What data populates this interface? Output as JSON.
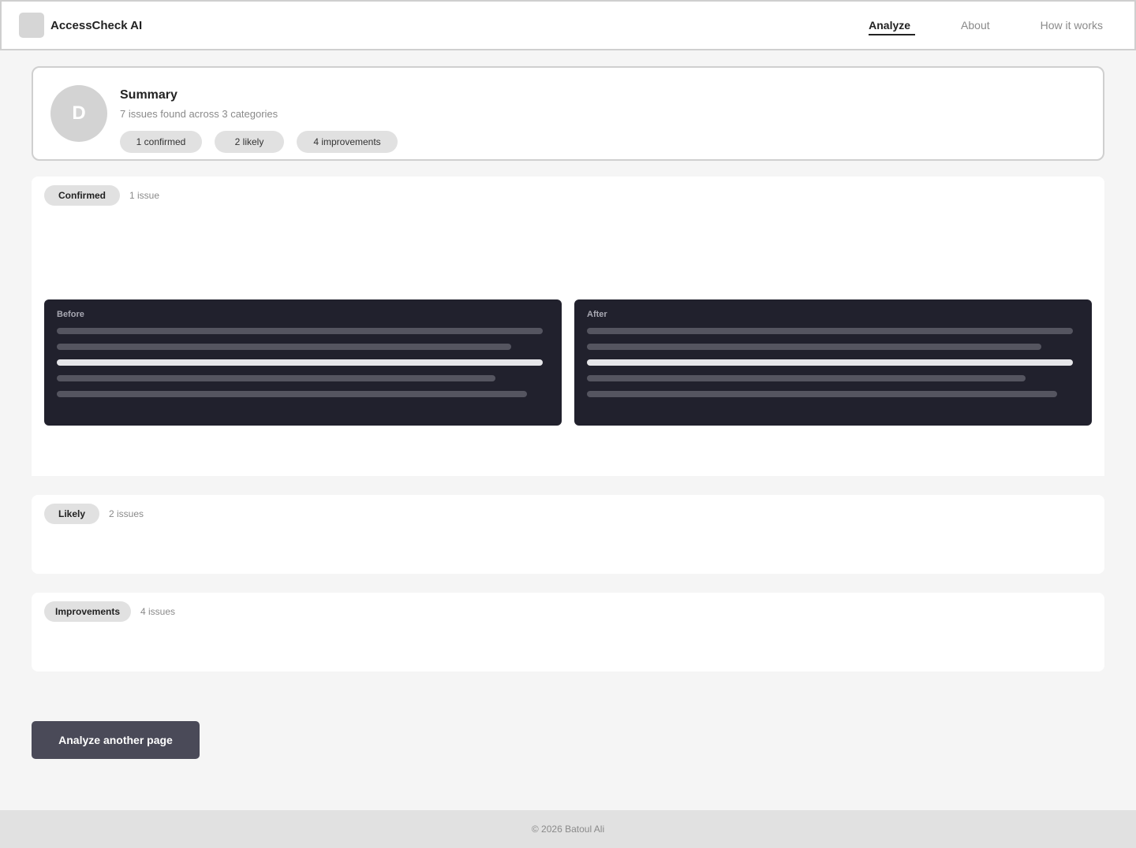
{
  "header": {
    "brand": "AccessCheck AI",
    "logo_icon": "app-logo-icon",
    "nav": [
      {
        "label": "Analyze",
        "active": true
      },
      {
        "label": "About",
        "active": false
      },
      {
        "label": "How it works",
        "active": false
      }
    ]
  },
  "summary": {
    "avatar_letter": "D",
    "title": "Summary",
    "subtitle": "7 issues found across 3 categories",
    "chips": [
      "1 confirmed",
      "2 likely",
      "4 improvements"
    ]
  },
  "sections": {
    "confirmed": {
      "tag": "Confirmed",
      "count": "1 issue",
      "before_label": "Before",
      "after_label": "After"
    },
    "likely": {
      "tag": "Likely",
      "count": "2 issues"
    },
    "improvements": {
      "tag": "Improvements",
      "count": "4 issues"
    }
  },
  "actions": {
    "analyze_again": "Analyze another page"
  },
  "footer": {
    "copyright": "© 2026 Batoul Ali"
  },
  "colors": {
    "background": "#f5f5f5",
    "panel": "#21212d",
    "button": "#4a4a58",
    "chip": "#e1e1e1",
    "highlight_line": "#e6e6e9"
  }
}
